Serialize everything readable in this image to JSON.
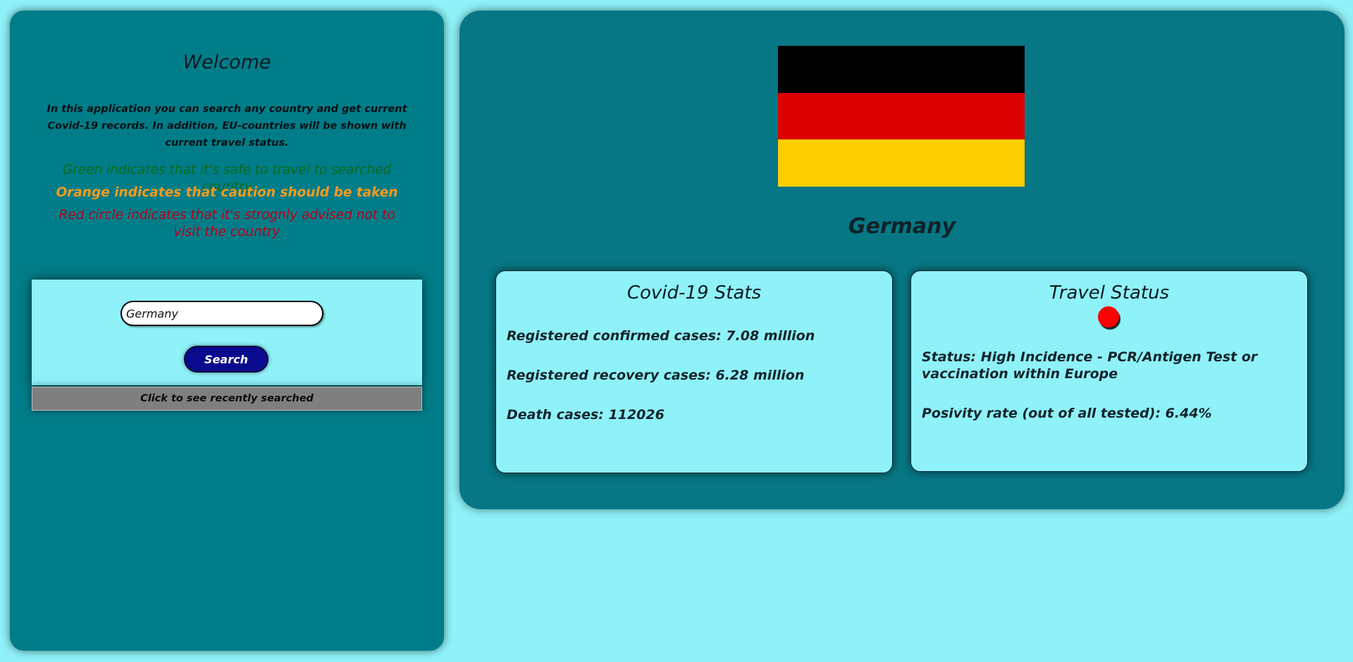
{
  "sidebar": {
    "title": "Welcome",
    "intro": "In this application you can search any country and get current Covid-19 records. In addition, EU-countries will be shown with current travel status.",
    "legend": {
      "green": "Green indicates that it's safe to travel to searched country",
      "orange": "Orange indicates that caution should be taken",
      "red": "Red circle indicates that it's strognly advised not to visit the country"
    },
    "search": {
      "value": "Germany",
      "button_label": "Search"
    },
    "recent_label": "Click to see recently searched"
  },
  "country": {
    "name": "Germany",
    "flag_colors": [
      "#000000",
      "#dd0000",
      "#ffce00"
    ]
  },
  "covid_stats": {
    "title": "Covid-19 Stats",
    "confirmed": "Registered confirmed cases: 7.08 million",
    "recovered": "Registered recovery cases: 6.28 million",
    "deaths": "Death cases: 112026"
  },
  "travel_status": {
    "title": "Travel Status",
    "indicator_color": "#fb0000",
    "status": "Status: High Incidence - PCR/Antigen Test or vaccination within Europe",
    "positivity": "Posivity rate (out of all tested): 6.44%"
  }
}
